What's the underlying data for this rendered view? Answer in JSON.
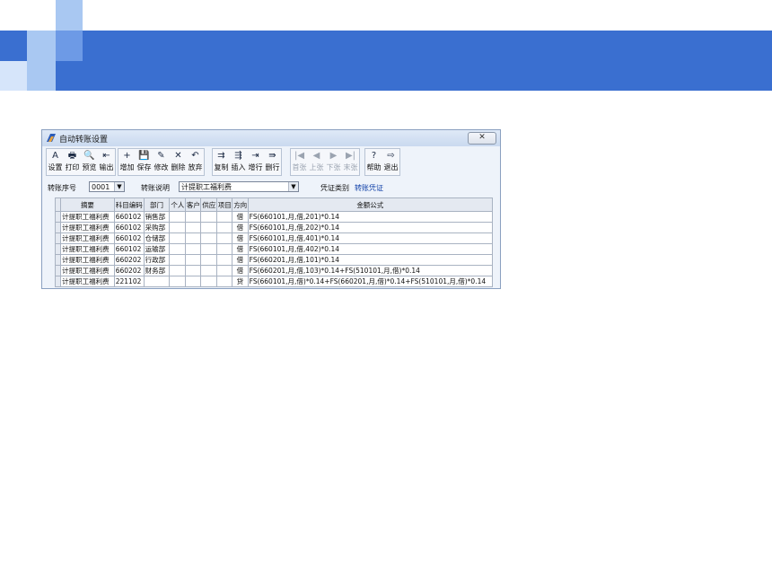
{
  "slide": {
    "colors": {
      "banner": "#3a6fd0",
      "square_light": "#a9c8f2",
      "square_mid": "#6d9ae6",
      "square_pale": "#d6e5fa"
    }
  },
  "window": {
    "title": "自动转账设置",
    "close_label": "✕"
  },
  "toolbar": {
    "groups": [
      [
        {
          "label": "设置",
          "icon": "A"
        },
        {
          "label": "打印",
          "icon": "🖶"
        },
        {
          "label": "预览",
          "icon": "🔍"
        },
        {
          "label": "输出",
          "icon": "⇤"
        }
      ],
      [
        {
          "label": "增加",
          "icon": "+"
        },
        {
          "label": "保存",
          "icon": "💾"
        },
        {
          "label": "修改",
          "icon": "✎"
        },
        {
          "label": "删除",
          "icon": "✕"
        },
        {
          "label": "放弃",
          "icon": "↶"
        }
      ],
      [
        {
          "label": "复制",
          "icon": "⇉"
        },
        {
          "label": "插入",
          "icon": "⇶"
        },
        {
          "label": "增行",
          "icon": "⇥"
        },
        {
          "label": "删行",
          "icon": "⇛"
        }
      ],
      [
        {
          "label": "首张",
          "icon": "|◀"
        },
        {
          "label": "上张",
          "icon": "◀"
        },
        {
          "label": "下张",
          "icon": "▶"
        },
        {
          "label": "末张",
          "icon": "▶|"
        }
      ],
      [
        {
          "label": "帮助",
          "icon": "?"
        },
        {
          "label": "退出",
          "icon": "⇨"
        }
      ]
    ]
  },
  "form": {
    "seq_label": "转账序号",
    "seq_value": "0001",
    "desc_label": "转账说明",
    "desc_value": "计提职工福利费",
    "type_label": "凭证类别",
    "type_value": "转账凭证"
  },
  "table": {
    "headers": [
      "摘要",
      "科目编码",
      "部门",
      "个人",
      "客户",
      "供应商",
      "项目",
      "方向",
      "金额公式"
    ],
    "rows": [
      [
        "计提职工福利费",
        "660102",
        "销售部",
        "",
        "",
        "",
        "",
        "借",
        "FS(660101,月,借,201)*0.14"
      ],
      [
        "计提职工福利费",
        "660102",
        "采购部",
        "",
        "",
        "",
        "",
        "借",
        "FS(660101,月,借,202)*0.14"
      ],
      [
        "计提职工福利费",
        "660102",
        "仓储部",
        "",
        "",
        "",
        "",
        "借",
        "FS(660101,月,借,401)*0.14"
      ],
      [
        "计提职工福利费",
        "660102",
        "运输部",
        "",
        "",
        "",
        "",
        "借",
        "FS(660101,月,借,402)*0.14"
      ],
      [
        "计提职工福利费",
        "660202",
        "行政部",
        "",
        "",
        "",
        "",
        "借",
        "FS(660201,月,借,101)*0.14"
      ],
      [
        "计提职工福利费",
        "660202",
        "财务部",
        "",
        "",
        "",
        "",
        "借",
        "FS(660201,月,借,103)*0.14+FS(510101,月,借)*0.14"
      ],
      [
        "计提职工福利费",
        "221102",
        "",
        "",
        "",
        "",
        "",
        "贷",
        "FS(660101,月,借)*0.14+FS(660201,月,借)*0.14+FS(510101,月,借)*0.14"
      ]
    ]
  }
}
